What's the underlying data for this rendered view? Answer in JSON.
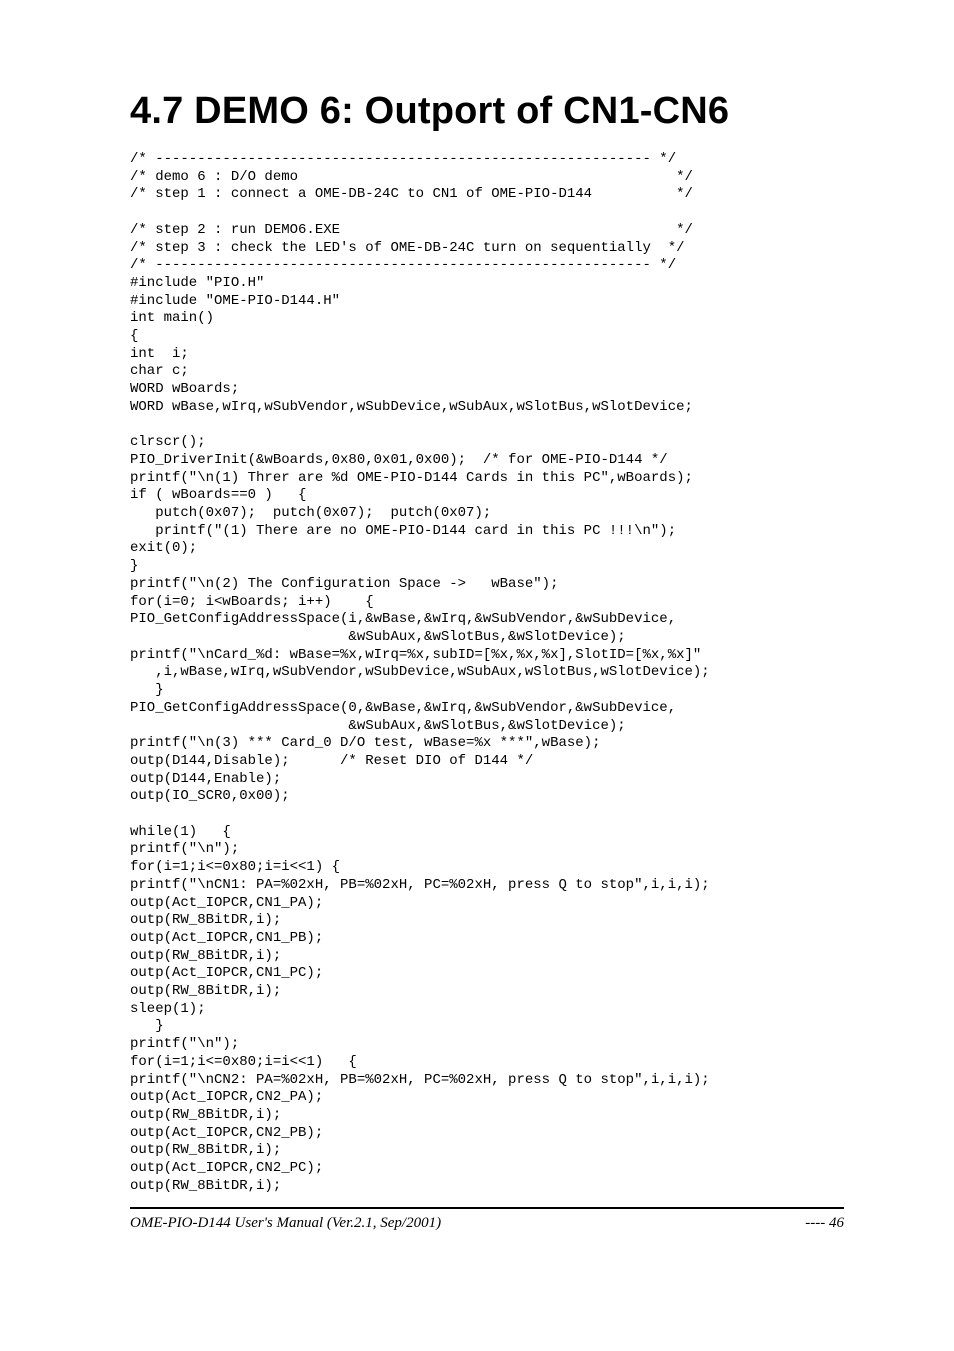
{
  "heading": "4.7   DEMO 6: Outport of CN1-CN6",
  "code": "/* ----------------------------------------------------------- */\n/* demo 6 : D/O demo                                             */\n/* step 1 : connect a OME-DB-24C to CN1 of OME-PIO-D144          */\n\n/* step 2 : run DEMO6.EXE                                        */\n/* step 3 : check the LED's of OME-DB-24C turn on sequentially  */\n/* ----------------------------------------------------------- */\n#include \"PIO.H\"\n#include \"OME-PIO-D144.H\"\nint main()\n{\nint  i;\nchar c;\nWORD wBoards;\nWORD wBase,wIrq,wSubVendor,wSubDevice,wSubAux,wSlotBus,wSlotDevice;\n\nclrscr();\nPIO_DriverInit(&wBoards,0x80,0x01,0x00);  /* for OME-PIO-D144 */\nprintf(\"\\n(1) Threr are %d OME-PIO-D144 Cards in this PC\",wBoards);\nif ( wBoards==0 )   {\n   putch(0x07);  putch(0x07);  putch(0x07);\n   printf(\"(1) There are no OME-PIO-D144 card in this PC !!!\\n\");\nexit(0);\n}\nprintf(\"\\n(2) The Configuration Space ->   wBase\");\nfor(i=0; i<wBoards; i++)    {\nPIO_GetConfigAddressSpace(i,&wBase,&wIrq,&wSubVendor,&wSubDevice,\n                          &wSubAux,&wSlotBus,&wSlotDevice);\nprintf(\"\\nCard_%d: wBase=%x,wIrq=%x,subID=[%x,%x,%x],SlotID=[%x,%x]\"\n   ,i,wBase,wIrq,wSubVendor,wSubDevice,wSubAux,wSlotBus,wSlotDevice);\n   }\nPIO_GetConfigAddressSpace(0,&wBase,&wIrq,&wSubVendor,&wSubDevice,\n                          &wSubAux,&wSlotBus,&wSlotDevice);\nprintf(\"\\n(3) *** Card_0 D/O test, wBase=%x ***\",wBase);\noutp(D144,Disable);      /* Reset DIO of D144 */\noutp(D144,Enable);\noutp(IO_SCR0,0x00);\n\nwhile(1)   {\nprintf(\"\\n\");\nfor(i=1;i<=0x80;i=i<<1) {\nprintf(\"\\nCN1: PA=%02xH, PB=%02xH, PC=%02xH, press Q to stop\",i,i,i);\noutp(Act_IOPCR,CN1_PA);\noutp(RW_8BitDR,i);\noutp(Act_IOPCR,CN1_PB);\noutp(RW_8BitDR,i);\noutp(Act_IOPCR,CN1_PC);\noutp(RW_8BitDR,i);\nsleep(1);\n   }\nprintf(\"\\n\");\nfor(i=1;i<=0x80;i=i<<1)   {\nprintf(\"\\nCN2: PA=%02xH, PB=%02xH, PC=%02xH, press Q to stop\",i,i,i);\noutp(Act_IOPCR,CN2_PA);\noutp(RW_8BitDR,i);\noutp(Act_IOPCR,CN2_PB);\noutp(RW_8BitDR,i);\noutp(Act_IOPCR,CN2_PC);\noutp(RW_8BitDR,i);",
  "footer_left": "OME-PIO-D144 User's Manual  (Ver.2.1, Sep/2001)",
  "footer_right": "----  46"
}
